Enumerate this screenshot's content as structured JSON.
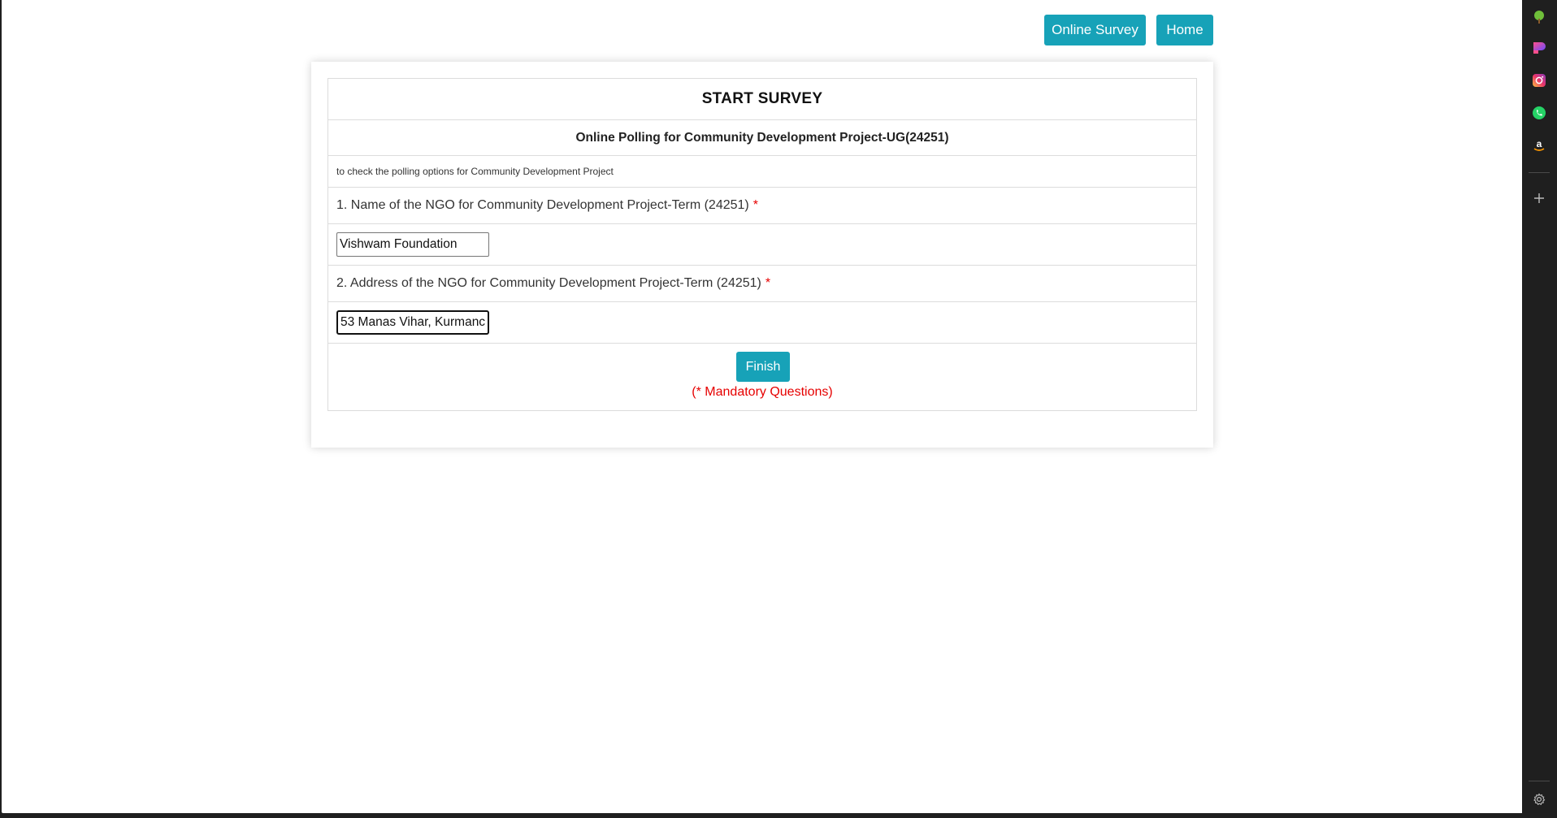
{
  "nav": {
    "online_survey_label": "Online Survey",
    "home_label": "Home"
  },
  "survey": {
    "heading": "START SURVEY",
    "title": "Online Polling for Community Development Project-UG(24251)",
    "description": "to check the polling options for Community Development Project",
    "questions": [
      {
        "label": "1. Name of the NGO for Community Development Project-Term (24251)",
        "required_mark": "*",
        "value": "Vishwam Foundation"
      },
      {
        "label": "2. Address of the NGO for Community Development Project-Term (24251)",
        "required_mark": "*",
        "value": "53 Manas Vihar, Kurmanc"
      }
    ],
    "finish_label": "Finish",
    "mandatory_note": "(* Mandatory Questions)"
  },
  "sidebar": {
    "icons": [
      "tree-icon",
      "gradient-app-icon",
      "instagram-icon",
      "whatsapp-icon",
      "amazon-icon",
      "add-icon",
      "settings-icon"
    ]
  },
  "colors": {
    "accent": "#17a2b8",
    "required": "#e60000",
    "browser_frame": "#1f1f1f"
  }
}
